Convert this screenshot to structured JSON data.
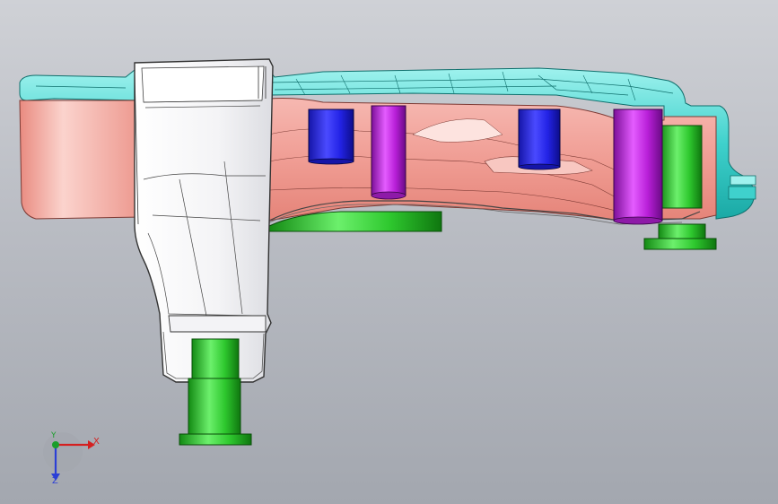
{
  "viewport": {
    "view": "cad-3d-model-view",
    "background_top": "#cfd1d6",
    "background_bottom": "#a3a7af"
  },
  "model": {
    "parts": [
      {
        "name": "tank-body",
        "color": "#f2a9a1"
      },
      {
        "name": "cover-top",
        "color": "#3fd1cc"
      },
      {
        "name": "bracket",
        "color": "#ffffff"
      },
      {
        "name": "cylinder-blue",
        "color": "#2323e6"
      },
      {
        "name": "cylinder-magenta",
        "color": "#b81fd8"
      },
      {
        "name": "cylinder-green",
        "color": "#2ec82e"
      }
    ]
  },
  "triad": {
    "x_label": "X",
    "y_label": "Y",
    "z_label": "Z",
    "x_color": "#d42020",
    "y_color": "#1a9e2a",
    "z_color": "#2b3fd6"
  }
}
